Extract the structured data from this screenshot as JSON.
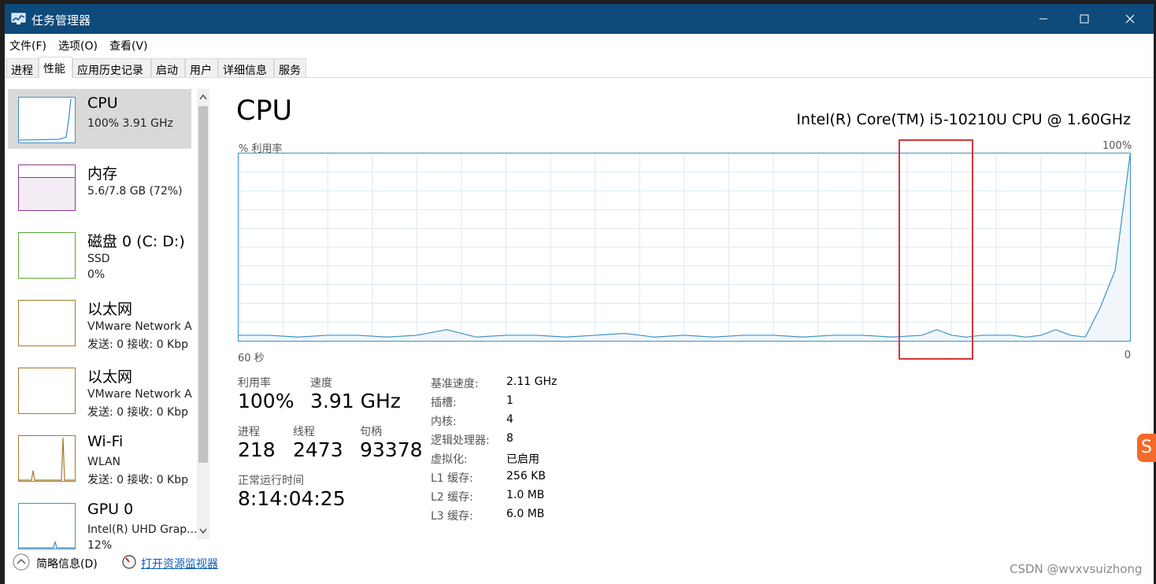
{
  "window": {
    "title": "任务管理器"
  },
  "menu": [
    "文件(F)",
    "选项(O)",
    "查看(V)"
  ],
  "tabs": [
    "进程",
    "性能",
    "应用历史记录",
    "启动",
    "用户",
    "详细信息",
    "服务"
  ],
  "active_tab": "性能",
  "sidebar": [
    {
      "name": "CPU",
      "line1": "100% 3.91 GHz",
      "line2": "",
      "color": "#4a90c2",
      "selected": true
    },
    {
      "name": "内存",
      "line1": "5.6/7.8 GB (72%)",
      "line2": "",
      "color": "#8b3a93"
    },
    {
      "name": "磁盘 0 (C: D:)",
      "line1": "SSD",
      "line2": "0%",
      "color": "#5aa83a"
    },
    {
      "name": "以太网",
      "line1": "VMware Network A",
      "line2": "发送: 0 接收: 0 Kbp",
      "color": "#a8792a"
    },
    {
      "name": "以太网",
      "line1": "VMware Network A",
      "line2": "发送: 0 接收: 0 Kbp",
      "color": "#a8792a"
    },
    {
      "name": "Wi-Fi",
      "line1": "WLAN",
      "line2": "发送: 0 接收: 0 Kbp",
      "color": "#a8792a"
    },
    {
      "name": "GPU 0",
      "line1": "Intel(R) UHD Grap...",
      "line2": "12%",
      "color": "#4a90c2"
    }
  ],
  "main": {
    "title": "CPU",
    "cpu_name": "Intel(R) Core(TM) i5-10210U CPU @ 1.60GHz",
    "graph_label": "% 利用率",
    "graph_max": "100%",
    "graph_time": "60 秒",
    "graph_min": "0",
    "stats": {
      "util_label": "利用率",
      "util_value": "100%",
      "speed_label": "速度",
      "speed_value": "3.91 GHz",
      "proc_label": "进程",
      "proc_value": "218",
      "thread_label": "线程",
      "thread_value": "2473",
      "handle_label": "句柄",
      "handle_value": "93378",
      "uptime_label": "正常运行时间",
      "uptime_value": "8:14:04:25"
    },
    "details": [
      {
        "k": "基准速度:",
        "v": "2.11 GHz"
      },
      {
        "k": "插槽:",
        "v": "1"
      },
      {
        "k": "内核:",
        "v": "4"
      },
      {
        "k": "逻辑处理器:",
        "v": "8"
      },
      {
        "k": "虚拟化:",
        "v": "已启用"
      },
      {
        "k": "L1 缓存:",
        "v": "256 KB"
      },
      {
        "k": "L2 缓存:",
        "v": "1.0 MB"
      },
      {
        "k": "L3 缓存:",
        "v": "6.0 MB"
      }
    ]
  },
  "footer": {
    "brief": "简略信息(D)",
    "monitor": "打开资源监视器"
  },
  "watermark": "CSDN @wvxvsuizhong",
  "accent_colors": {
    "titlebar": "#0e4a7a",
    "cpu_line": "#3c91c4",
    "highlight": "#d2363a"
  },
  "chart_data": {
    "type": "area",
    "title": "",
    "ylabel": "% 利用率",
    "ylim": [
      0,
      100
    ],
    "x": [
      60,
      58,
      56,
      54,
      52,
      50,
      48,
      46,
      44,
      42,
      40,
      38,
      36,
      34,
      32,
      30,
      28,
      26,
      24,
      22,
      20,
      18,
      16,
      14,
      13,
      12,
      11,
      10,
      9,
      8,
      7,
      6,
      5,
      4,
      3,
      2,
      1,
      0
    ],
    "y": [
      3,
      3,
      2,
      3,
      3,
      2,
      3,
      6,
      2,
      3,
      3,
      2,
      3,
      4,
      2,
      3,
      2,
      3,
      3,
      2,
      3,
      3,
      2,
      3,
      6,
      3,
      2,
      3,
      3,
      3,
      2,
      3,
      6,
      3,
      2,
      18,
      38,
      100
    ],
    "x_range_seconds": [
      60,
      0
    ]
  }
}
